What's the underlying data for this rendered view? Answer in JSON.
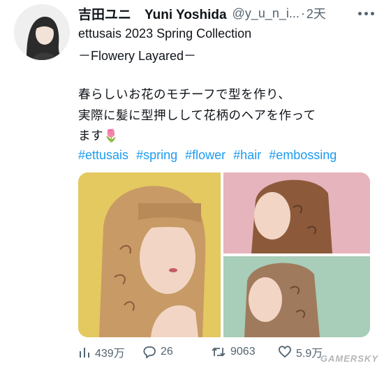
{
  "tweet": {
    "display_name": "吉田ユニ　Yuni Yoshida",
    "handle": "@y_u_n_i...",
    "dot": "·",
    "time": "2天",
    "line1": "ettusais  2023 Spring Collection",
    "line2": "－Flowery Layared－",
    "body1": "春らしいお花のモチーフで型を作り、",
    "body2": "実際に髪に型押しして花柄のヘアを作って",
    "body3": "ます",
    "emoji": "🌷",
    "hashtags": [
      "#ettusais",
      "#spring",
      "#flower",
      "#hair",
      "#embossing"
    ]
  },
  "media": {
    "colors": {
      "left_bg": "#e4c860",
      "top_right_bg": "#e6b4bd",
      "bottom_right_bg": "#a8cdb8",
      "hair": "#c79a66",
      "hair_dark": "#8c5a3b",
      "skin": "#f2d5c4"
    }
  },
  "actions": {
    "views": "439万",
    "replies": "26",
    "retweets": "9063",
    "likes": "5.9万"
  },
  "watermark": "GAMERSKY",
  "icons": {
    "views": "bar-chart-icon",
    "replies": "reply-icon",
    "retweets": "retweet-icon",
    "likes": "heart-icon",
    "more": "more-icon"
  },
  "accent": "#1d9bf0"
}
